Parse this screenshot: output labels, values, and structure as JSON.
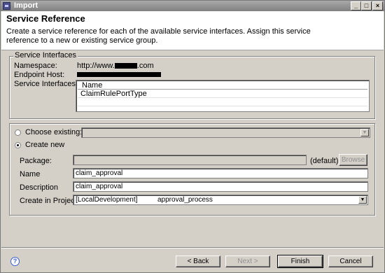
{
  "window": {
    "title": "Import"
  },
  "header": {
    "title": "Service Reference",
    "description": "Create a service reference for each of the available service interfaces. Assign this service reference to a new or existing service group."
  },
  "service_interfaces": {
    "legend": "Service Interfaces",
    "namespace_label": "Namespace:",
    "namespace_value": "http://www.",
    "namespace_suffix": ".com",
    "endpoint_label": "Endpoint Host:",
    "interfaces_label": "Service Interfaces:",
    "table": {
      "column": "Name",
      "rows": [
        "ClaimRulePortType"
      ]
    }
  },
  "group": {
    "choose_existing_label": "Choose existing:",
    "create_new_label": "Create new",
    "package_label": "Package:",
    "package_default": "(default)",
    "browse_label": "Browse",
    "name_label": "Name",
    "name_value": "claim_approval",
    "description_label": "Description",
    "description_value": "claim_approval",
    "project_label": "Create in Project:",
    "project_value": "[LocalDevelopment]",
    "project_value_2": "approval_process"
  },
  "footer": {
    "back_label": "< Back",
    "next_label": "Next >",
    "finish_label": "Finish",
    "cancel_label": "Cancel"
  },
  "icons": {
    "help": "help-icon",
    "app": "app-icon"
  }
}
